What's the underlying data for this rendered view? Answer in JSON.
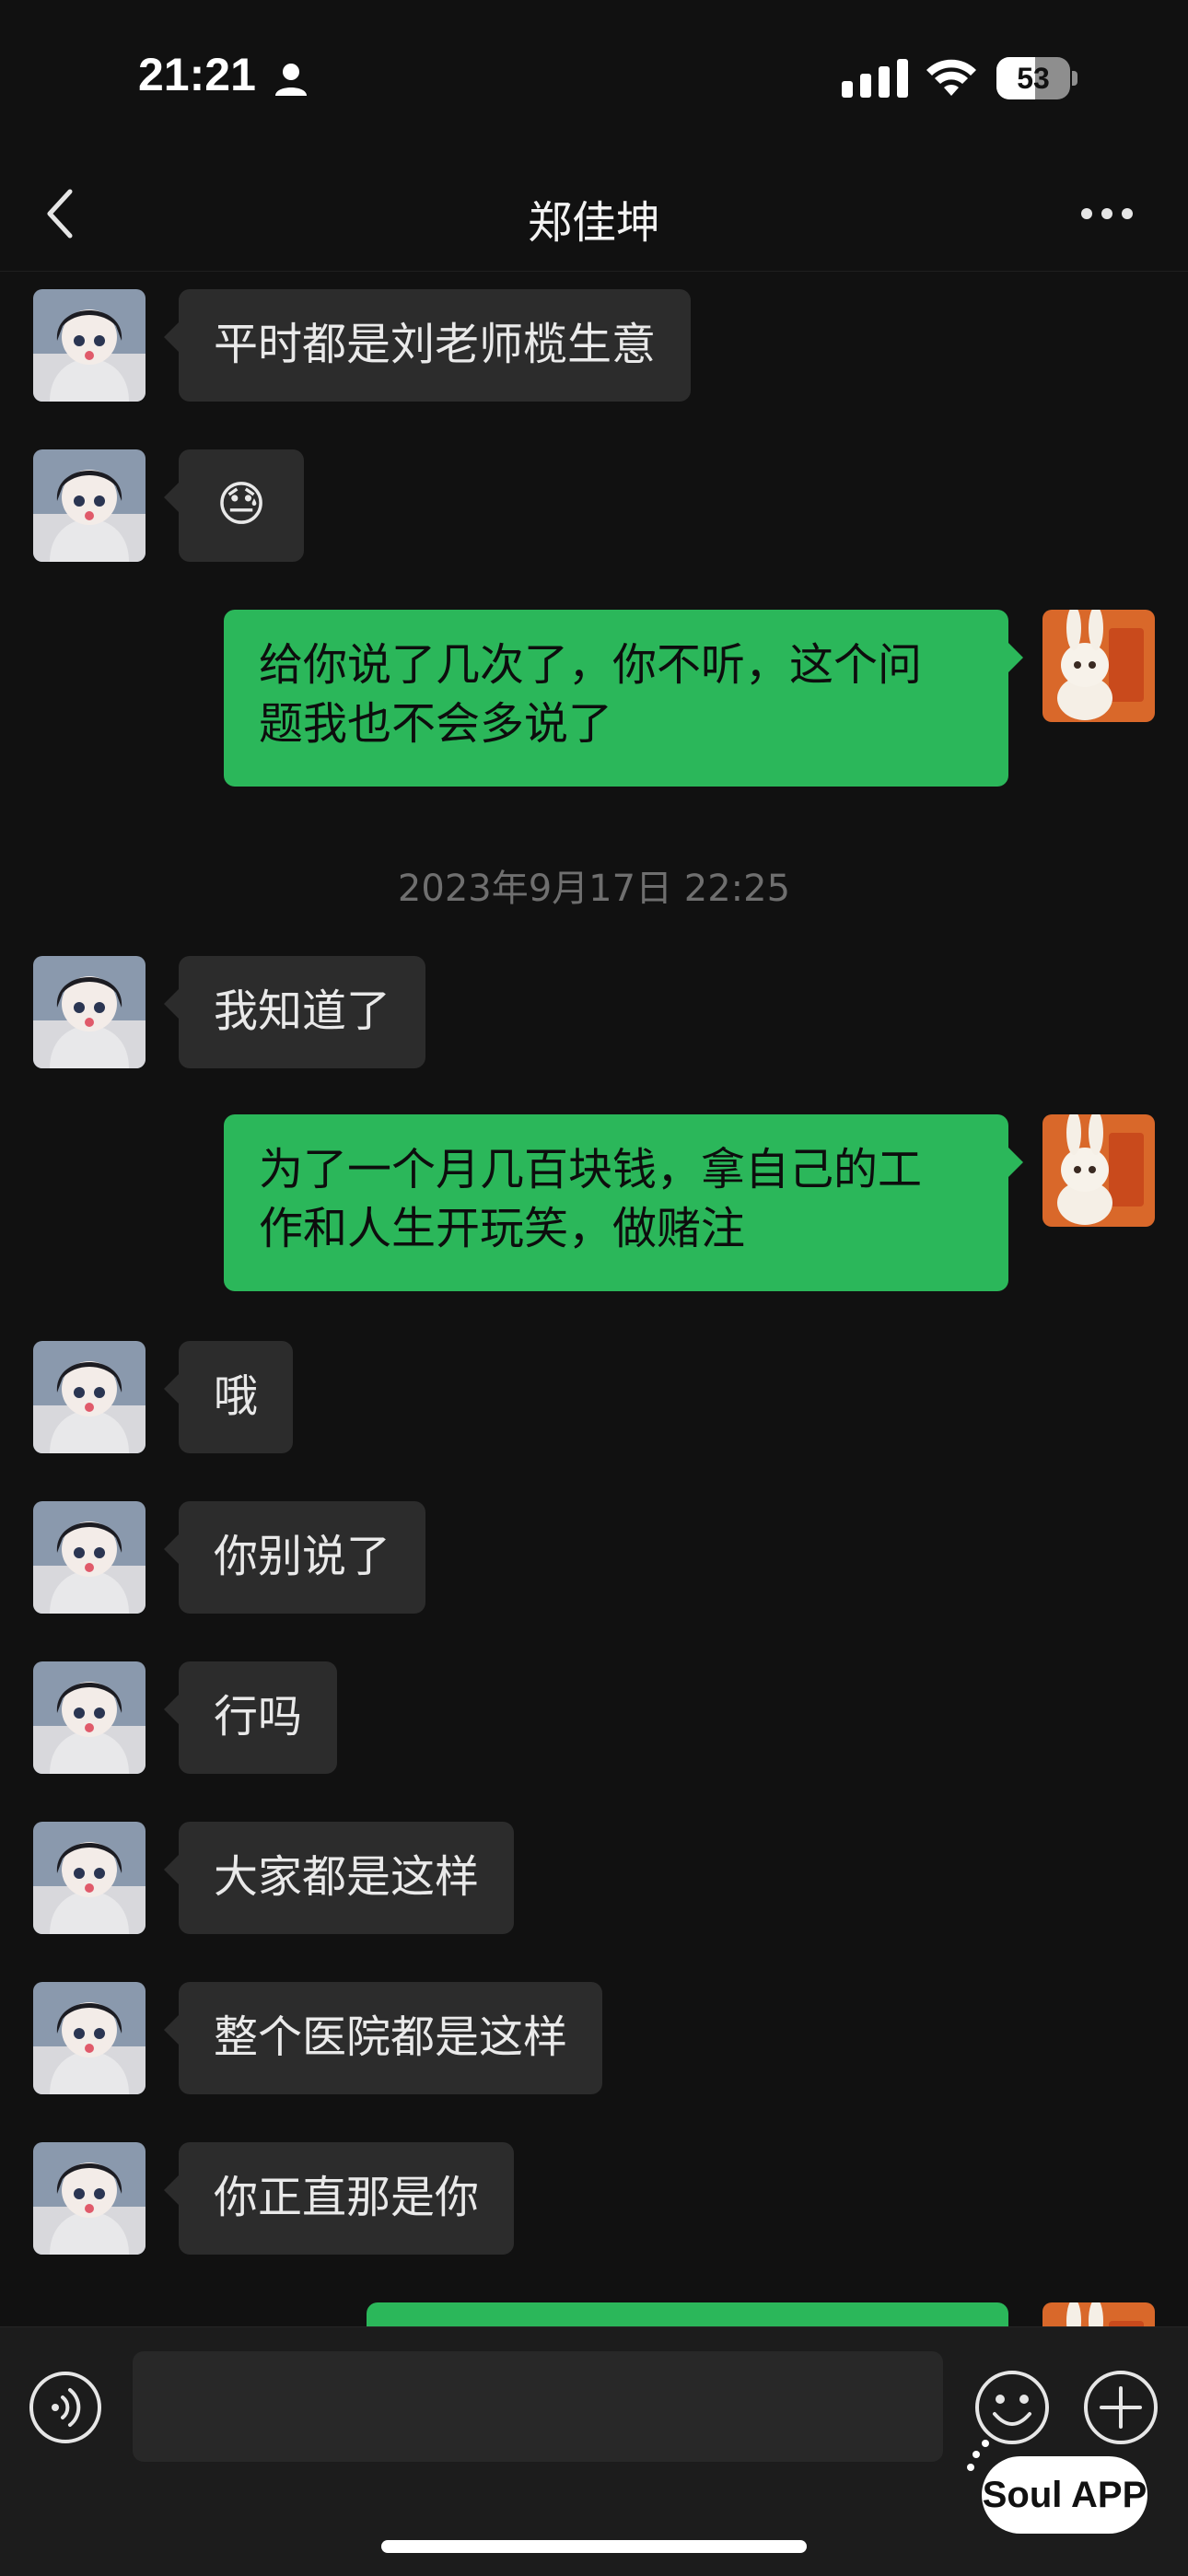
{
  "status_bar": {
    "time": "21:21",
    "battery_percent": 53,
    "battery_label": "53"
  },
  "nav": {
    "title": "郑佳坤"
  },
  "messages": [
    {
      "from": "contact",
      "text": "平时都是刘老师榄生意"
    },
    {
      "from": "contact",
      "text": "😓"
    },
    {
      "from": "me",
      "text": "给你说了几次了，你不听，这个问\n题我也不会多说了"
    },
    {
      "type": "timestamp",
      "text": "2023年9月17日 22:25"
    },
    {
      "from": "contact",
      "text": "我知道了"
    },
    {
      "from": "me",
      "text": "为了一个月几百块钱，拿自己的工\n作和人生开玩笑，做赌注"
    },
    {
      "from": "contact",
      "text": "哦"
    },
    {
      "from": "contact",
      "text": "你别说了"
    },
    {
      "from": "contact",
      "text": "行吗"
    },
    {
      "from": "contact",
      "text": "大家都是这样"
    },
    {
      "from": "contact",
      "text": "整个医院都是这样"
    },
    {
      "from": "contact",
      "text": "你正直那是你"
    },
    {
      "from": "me",
      "text": ""
    }
  ],
  "input_bar": {
    "placeholder": "",
    "watermark": "Soul APP"
  },
  "colors": {
    "background": "#111111",
    "incoming_bubble": "#2c2c2c",
    "outgoing_bubble": "#2bb75a"
  }
}
